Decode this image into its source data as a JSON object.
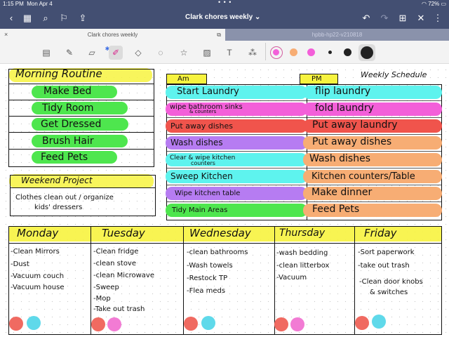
{
  "status": {
    "time": "1:15 PM",
    "date": "Mon Apr 4",
    "dots": "• • •",
    "battery": "72%"
  },
  "titlebar": {
    "title": "Clark chores weekly ⌄"
  },
  "tabs": [
    {
      "label": "Clark chores weekly",
      "close": "×",
      "extra": "⧉"
    },
    {
      "label": "hpbb-hp22-v210818"
    }
  ],
  "tools": {
    "bluetooth": "✱"
  },
  "colors": {
    "chrome": "#434f72",
    "yellow": "#f7f33f",
    "green": "#4ee64e",
    "cyan": "#5ef3ee",
    "pink": "#f35fd9",
    "red": "#f0544c",
    "purple": "#b67cf2",
    "orange": "#f7ad74",
    "dot_red": "#f06a61",
    "dot_cyan": "#5fd9ea",
    "dot_pink": "#f27bd4"
  },
  "morning": {
    "title": "Morning Routine",
    "items": [
      "Make Bed",
      "Tidy Room",
      "Get Dressed",
      "Brush Hair",
      "Feed Pets"
    ]
  },
  "weekend": {
    "title": "Weekend Project",
    "text1": "Clothes clean out / organize",
    "text2": "kids' dressers"
  },
  "schedule": {
    "title": "Weekly Schedule",
    "am_label": "Am",
    "pm_label": "PM",
    "am": [
      "Start Laundry",
      "wipe bathroom sinks",
      "Put away dishes",
      "Wash dishes",
      "Clear & wipe kitchen",
      "Sweep Kitchen",
      "Wipe kitchen table",
      "Tidy Main Areas"
    ],
    "am_sub": {
      "sinks": "& counters",
      "kitchen": "counters"
    },
    "pm": [
      "flip laundry",
      "fold laundry",
      "Put away laundry",
      "Put away dishes",
      "Wash dishes",
      "Kitchen counters/Table",
      "Make dinner",
      "Feed Pets"
    ]
  },
  "days": [
    {
      "name": "Monday",
      "tasks": [
        "-Clean Mirrors",
        "-Dust",
        "-Vacuum couch",
        "-Vacuum house"
      ]
    },
    {
      "name": "Tuesday",
      "tasks": [
        "-Clean fridge",
        "-clean stove",
        "-clean Microwave",
        "-Sweep",
        "-Mop",
        "-Take out trash"
      ]
    },
    {
      "name": "Wednesday",
      "tasks": [
        "-clean bathrooms",
        "-Wash towels",
        "-Restock TP",
        "-Flea meds"
      ]
    },
    {
      "name": "Thursday",
      "tasks": [
        "-wash bedding",
        "-clean litterbox",
        "-Vacuum"
      ]
    },
    {
      "name": "Friday",
      "tasks": [
        "-Sort paperwork",
        "-take out trash",
        "-Clean door knobs",
        "& switches"
      ]
    }
  ]
}
